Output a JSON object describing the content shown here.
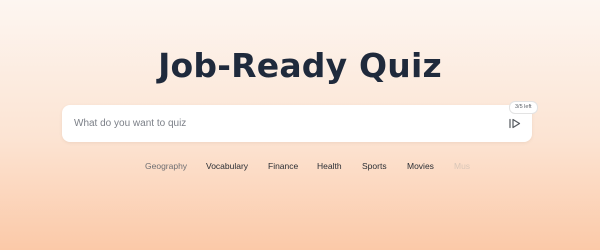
{
  "title": "Job-Ready Quiz",
  "search": {
    "placeholder": "What do you want to quiz",
    "quota": "3/5 left"
  },
  "icons": {
    "submit": "send-arrow-icon"
  },
  "topics": [
    "Geography",
    "Vocabulary",
    "Finance",
    "Health",
    "Sports",
    "Movies",
    "Mus"
  ],
  "colors": {
    "title": "#1f2a3c",
    "background_top": "#fdf6f1",
    "background_bottom": "#fbc9a8"
  }
}
